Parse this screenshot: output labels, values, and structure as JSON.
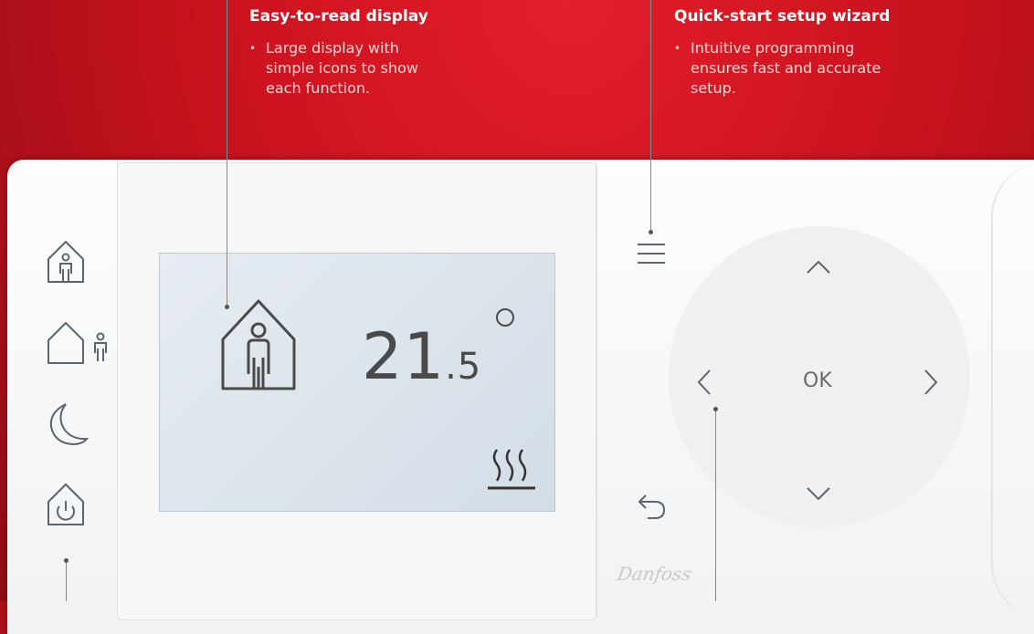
{
  "callouts": {
    "display": {
      "title": "Easy-to-read display",
      "items": [
        "Large display with simple icons to show each function."
      ]
    },
    "wizard": {
      "title": "Quick-start setup wizard",
      "items": [
        "Intuitive programming ensures fast and accurate setup."
      ]
    }
  },
  "display": {
    "temperature_whole": "21",
    "temperature_decimal": ".5"
  },
  "controls": {
    "ok_label": "OK"
  },
  "brand": {
    "logo_text": "Danfoss"
  },
  "icons": {
    "left_buttons": [
      "home-occupied-icon",
      "away-icon",
      "night-moon-icon",
      "standby-power-icon"
    ],
    "right_buttons": [
      "menu-icon",
      "up-arrow-icon",
      "left-arrow-icon",
      "right-arrow-icon",
      "down-arrow-icon",
      "back-icon"
    ],
    "display": [
      "house-person-icon",
      "heating-icon"
    ]
  },
  "colors": {
    "background_red": "#c9121e",
    "device_white": "#f5f5f6",
    "lcd": "#dce4eb"
  }
}
